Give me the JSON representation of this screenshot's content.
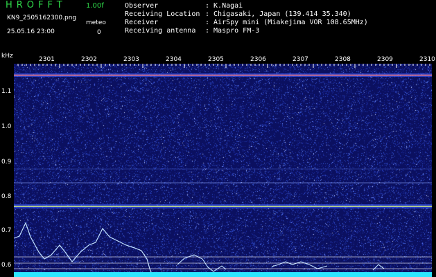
{
  "header": {
    "app_name": "HROFFT",
    "version": "1.00f",
    "file_name": "KN9_2505162300.png",
    "datetime": "25.05.16 23:00",
    "meteor_label": "meteo",
    "meteor_count": "0",
    "fields": [
      {
        "label": "Observer",
        "value": ": K.Nagai"
      },
      {
        "label": "Receiving Location",
        "value": ": Chigasaki, Japan (139.414 35.340)"
      },
      {
        "label": "Receiver",
        "value": ": AirSpy mini (Miakejima VOR 108.65MHz)"
      },
      {
        "label": "Receiving antenna",
        "value": ": Maspro FM-3"
      }
    ]
  },
  "plot": {
    "y_unit": "kHz",
    "y_ticks": [
      "1.1",
      "1.0",
      "0.9",
      "0.8",
      "0.7",
      "0.6"
    ],
    "x_ticks": [
      "2301",
      "2302",
      "2303",
      "2304",
      "2305",
      "2306",
      "2307",
      "2308",
      "2309",
      "2310"
    ],
    "colors": {
      "background": "#0b1060",
      "carrier": "#d8f07a",
      "trace": "#c0e0ff",
      "baseline": "#2ee6ff"
    }
  }
}
